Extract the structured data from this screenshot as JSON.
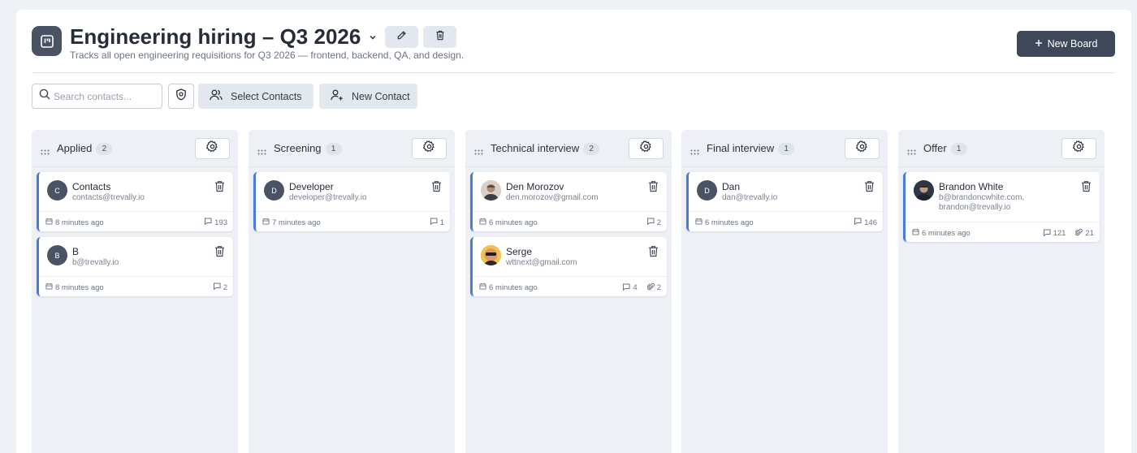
{
  "header": {
    "title": "Engineering hiring – Q3 2026",
    "subtitle": "Tracks all open engineering requisitions for Q3 2026 — frontend, backend, QA, and design.",
    "new_board_label": "New Board"
  },
  "toolbar": {
    "search_placeholder": "Search contacts...",
    "select_contacts_label": "Select Contacts",
    "new_contact_label": "New Contact"
  },
  "colors": {
    "accent": "#4a7bd6",
    "dark": "#3f4858",
    "column_bg": "#edf0f5"
  },
  "columns": [
    {
      "title": "Applied",
      "count": "2",
      "cards": [
        {
          "initial": "C",
          "name": "Contacts",
          "email": "contacts@trevally.io",
          "time": "8 minutes ago",
          "comments": "193",
          "attachments": ""
        },
        {
          "initial": "B",
          "name": "B",
          "email": "b@trevally.io",
          "time": "8 minutes ago",
          "comments": "2",
          "attachments": ""
        }
      ]
    },
    {
      "title": "Screening",
      "count": "1",
      "cards": [
        {
          "initial": "D",
          "name": "Developer",
          "email": "developer@trevally.io",
          "time": "7 minutes ago",
          "comments": "1",
          "attachments": ""
        }
      ]
    },
    {
      "title": "Technical interview",
      "count": "2",
      "cards": [
        {
          "initial": "",
          "name": "Den Morozov",
          "email": "den.morozov@gmail.com",
          "time": "6 minutes ago",
          "comments": "2",
          "attachments": ""
        },
        {
          "initial": "",
          "name": "Serge",
          "email": "wttnext@gmail.com",
          "time": "6 minutes ago",
          "comments": "4",
          "attachments": "2"
        }
      ]
    },
    {
      "title": "Final interview",
      "count": "1",
      "cards": [
        {
          "initial": "D",
          "name": "Dan",
          "email": "dan@trevally.io",
          "time": "6 minutes ago",
          "comments": "146",
          "attachments": ""
        }
      ]
    },
    {
      "title": "Offer",
      "count": "1",
      "cards": [
        {
          "initial": "",
          "name": "Brandon White",
          "email": "b@brandoncwhite.com, brandon@trevally.io",
          "time": "6 minutes ago",
          "comments": "121",
          "attachments": "21"
        }
      ]
    }
  ]
}
